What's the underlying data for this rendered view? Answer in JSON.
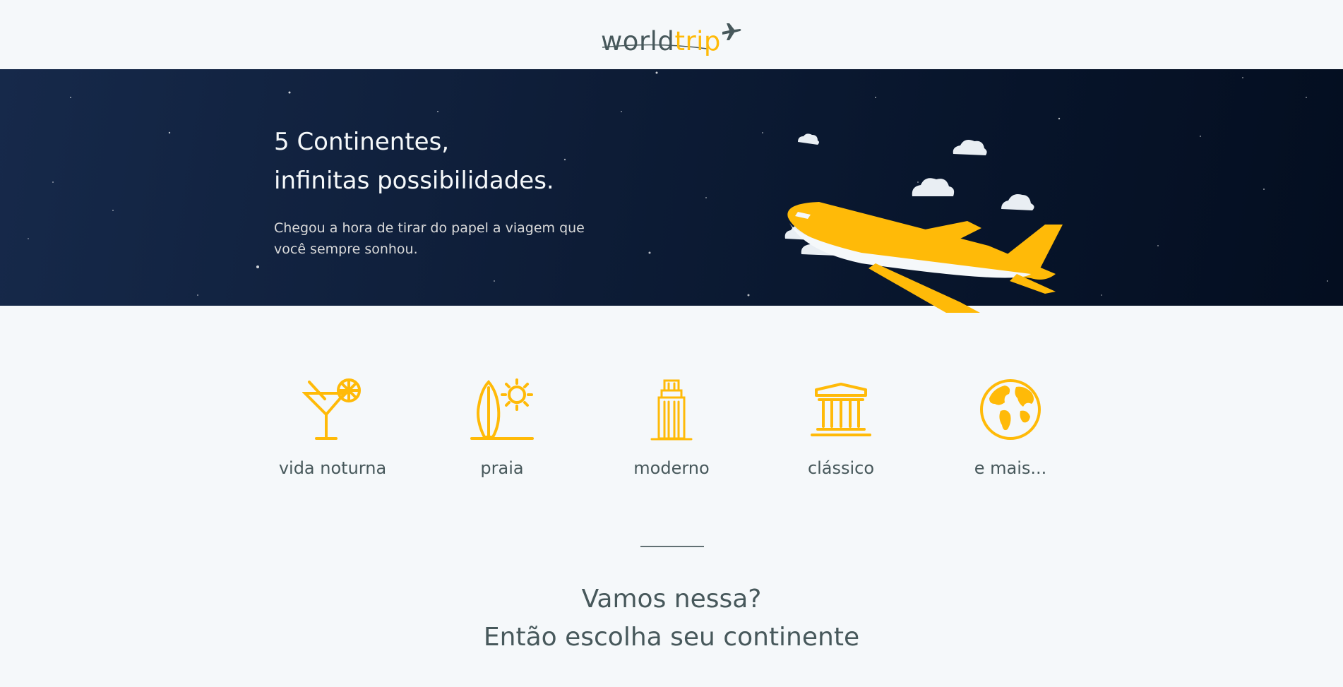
{
  "header": {
    "logo_world": "world",
    "logo_trip": "trip",
    "logo_icon": "airplane-icon"
  },
  "banner": {
    "title_line1": "5 Continentes,",
    "title_line2": "infinitas possibilidades.",
    "subtitle_line1": "Chegou a hora de tirar do papel a viagem que",
    "subtitle_line2": "você sempre sonhou.",
    "illustration": "airplane-with-clouds"
  },
  "categories": [
    {
      "label": "vida noturna",
      "icon": "cocktail-icon"
    },
    {
      "label": "praia",
      "icon": "surf-sun-icon"
    },
    {
      "label": "moderno",
      "icon": "skyscraper-icon"
    },
    {
      "label": "clássico",
      "icon": "museum-icon"
    },
    {
      "label": "e mais...",
      "icon": "globe-icon"
    }
  ],
  "cta": {
    "line1": "Vamos nessa?",
    "line2": "Então escolha seu continente"
  },
  "colors": {
    "accent": "#ffba08",
    "text": "#47585b",
    "background": "#f5f8fa",
    "banner": "#0d1c36"
  }
}
